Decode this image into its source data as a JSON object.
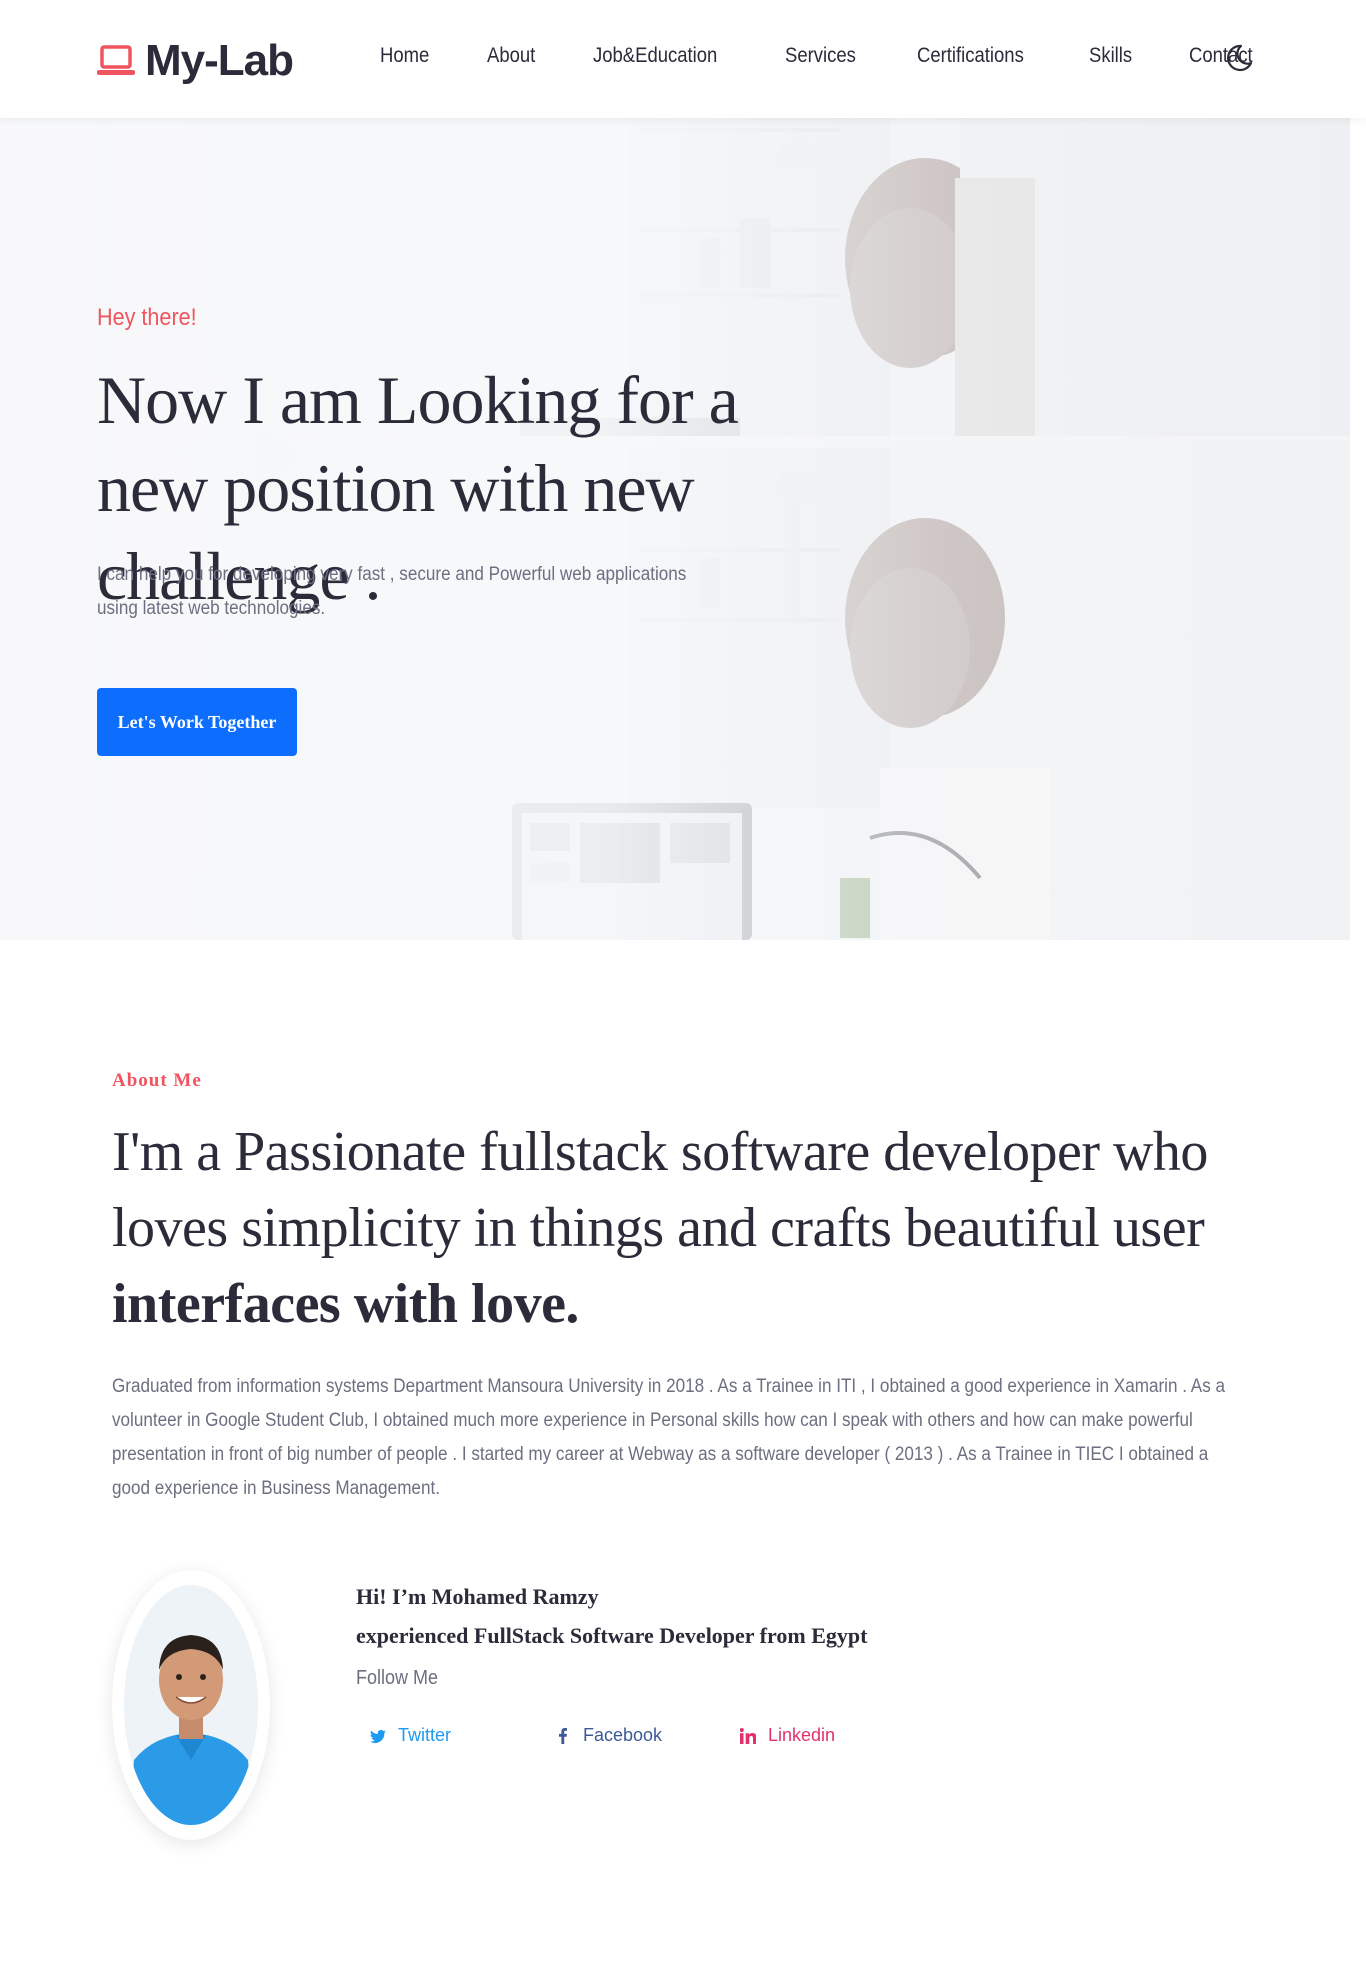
{
  "header": {
    "logo_text": "My-Lab",
    "nav": [
      "Home",
      "About",
      "Job&Education",
      "Services",
      "Certifications",
      "Skills",
      "Contact"
    ]
  },
  "hero": {
    "kicker": "Hey there!",
    "title": "Now I am Looking for a new position with new challenge .",
    "description": "I can help you for developing very fast , secure and Powerful web applications using latest web technologies.",
    "cta_label": "Let's Work Together"
  },
  "about": {
    "kicker": "About Me",
    "title_regular": "I'm a Passionate fullstack software developer who loves simplicity in things and crafts beautiful user",
    "title_bold": "interfaces with love.",
    "description": "Graduated from information systems Department Mansoura University in 2018 . As a Trainee in ITI , I obtained a good experience in Xamarin . As a volunteer in Google Student Club, I obtained much more experience in Personal skills how can I speak with others and how can make powerful presentation in front of big number of people . I started my career at Webway as a software developer ( 2013 ) . As a Trainee in TIEC I obtained a good experience in Business Management."
  },
  "profile": {
    "name_line": "Hi! I’m Mohamed Ramzy",
    "role_line": "experienced FullStack Software Developer from Egypt",
    "follow_label": "Follow Me",
    "socials": [
      {
        "label": "Twitter",
        "icon": "twitter-icon",
        "color": "#1d9bf0"
      },
      {
        "label": "Facebook",
        "icon": "facebook-icon",
        "color": "#3b5998"
      },
      {
        "label": "Linkedin",
        "icon": "linkedin-icon",
        "color": "#e4306c"
      }
    ]
  },
  "colors": {
    "accent": "#f0555f",
    "primary_button": "#0d6efd",
    "text_dark": "#2b2b3a",
    "text_muted": "#6b6f80"
  }
}
